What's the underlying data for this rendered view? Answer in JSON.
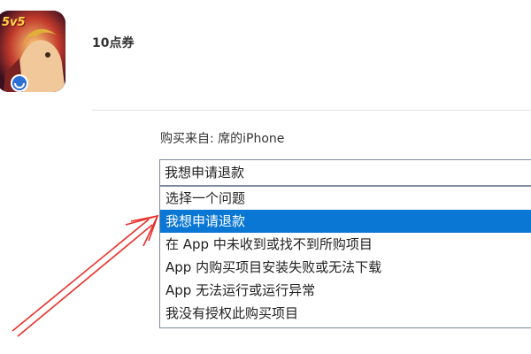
{
  "app_icon": {
    "badge_text": "5v5",
    "description": "hero portrait game icon"
  },
  "item": {
    "title": "10点券"
  },
  "purchase": {
    "from_label": "购买来自: 席的iPhone"
  },
  "reason_select": {
    "current_value": "我想申请退款",
    "options": [
      {
        "label": "选择一个问题",
        "selected": false
      },
      {
        "label": "我想申请退款",
        "selected": true
      },
      {
        "label": "在 App 中未收到或找不到所购项目",
        "selected": false
      },
      {
        "label": "App 内购买项目安装失败或无法下载",
        "selected": false
      },
      {
        "label": "App 无法运行或运行异常",
        "selected": false
      },
      {
        "label": "我没有授权此购买项目",
        "selected": false
      }
    ]
  },
  "colors": {
    "highlight": "#0a77d5",
    "arrow": "#e8302a",
    "border": "#7f8b9c"
  },
  "annotation": {
    "arrow_icon": "red-pointer-arrow-icon"
  }
}
